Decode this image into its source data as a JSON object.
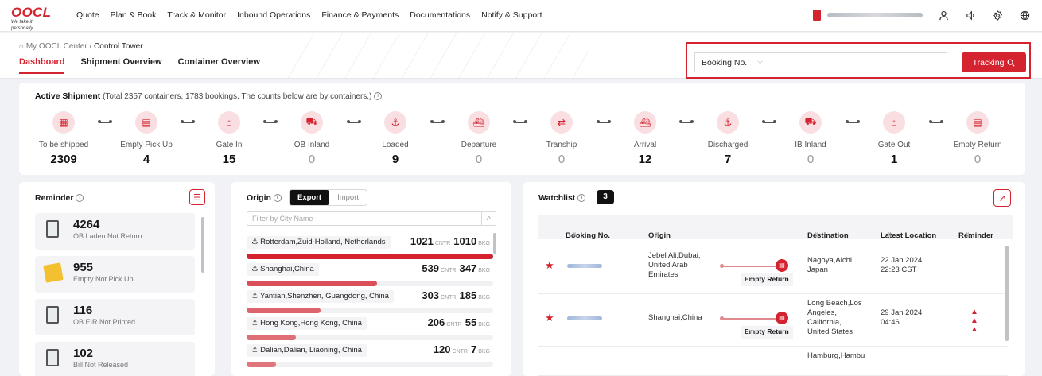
{
  "topbar": {
    "brand": "OOCL",
    "tagline": "We take it personally",
    "nav": [
      "Quote",
      "Plan & Book",
      "Track & Monitor",
      "Inbound Operations",
      "Finance & Payments",
      "Documentations",
      "Notify & Support"
    ]
  },
  "breadcrumb": {
    "root": "My OOCL Center",
    "sep": "/",
    "current": "Control Tower"
  },
  "tabs": [
    {
      "label": "Dashboard",
      "active": true
    },
    {
      "label": "Shipment Overview",
      "active": false
    },
    {
      "label": "Container Overview",
      "active": false
    }
  ],
  "search": {
    "type": "Booking No.",
    "button": "Tracking"
  },
  "active_shipment": {
    "title": "Active Shipment",
    "note": "(Total 2357 containers, 1783 bookings. The counts below are by containers.)",
    "stages": [
      {
        "label": "To be shipped",
        "count": "2309",
        "icon": "factory-icon"
      },
      {
        "label": "Empty Pick Up",
        "count": "4",
        "icon": "container-icon"
      },
      {
        "label": "Gate In",
        "count": "15",
        "icon": "gate-icon"
      },
      {
        "label": "OB Inland",
        "count": "0",
        "icon": "truck-icon"
      },
      {
        "label": "Loaded",
        "count": "9",
        "icon": "crane-icon"
      },
      {
        "label": "Departure",
        "count": "0",
        "icon": "ship-icon"
      },
      {
        "label": "Tranship",
        "count": "0",
        "icon": "tranship-icon"
      },
      {
        "label": "Arrival",
        "count": "12",
        "icon": "ship-icon"
      },
      {
        "label": "Discharged",
        "count": "7",
        "icon": "crane-icon"
      },
      {
        "label": "IB Inland",
        "count": "0",
        "icon": "truck-icon"
      },
      {
        "label": "Gate Out",
        "count": "1",
        "icon": "gate-icon"
      },
      {
        "label": "Empty Return",
        "count": "0",
        "icon": "container-icon"
      }
    ]
  },
  "reminder": {
    "title": "Reminder",
    "items": [
      {
        "count": "4264",
        "label": "OB Laden Not Return",
        "icon": "document-icon"
      },
      {
        "count": "955",
        "label": "Empty Not Pick Up",
        "icon": "box-icon"
      },
      {
        "count": "116",
        "label": "OB EIR Not Printed",
        "icon": "document-icon"
      },
      {
        "count": "102",
        "label": "Bill Not Released",
        "icon": "document-icon"
      }
    ]
  },
  "origin": {
    "title": "Origin",
    "export_label": "Export",
    "import_label": "Import",
    "filter_placeholder": "Filter by City Name",
    "unit_cntr": "CNTR",
    "unit_bkg": "BKG",
    "rows": [
      {
        "city": "Rotterdam,Zuid-Holland, Netherlands",
        "cntr": "1021",
        "bkg": "1010",
        "share": 1.0
      },
      {
        "city": "Shanghai,China",
        "cntr": "539",
        "bkg": "347",
        "share": 0.53
      },
      {
        "city": "Yantian,Shenzhen, Guangdong, China",
        "cntr": "303",
        "bkg": "185",
        "share": 0.3
      },
      {
        "city": "Hong Kong,Hong Kong, China",
        "cntr": "206",
        "bkg": "55",
        "share": 0.2
      },
      {
        "city": "Dalian,Dalian, Liaoning, China",
        "cntr": "120",
        "bkg": "7",
        "share": 0.12
      }
    ]
  },
  "watchlist": {
    "title": "Watchlist",
    "count": "3",
    "columns": [
      "Booking No.",
      "Origin",
      "Destination",
      "Latest Location",
      "Reminder"
    ],
    "rows": [
      {
        "origin": [
          "Jebel Ali,Dubai,",
          "United Arab",
          "Emirates"
        ],
        "status": "Empty Return",
        "destination": [
          "Nagoya,Aichi,",
          "Japan"
        ],
        "location": [
          "22 Jan 2024",
          "22:23 CST"
        ],
        "warnings": 0
      },
      {
        "origin": [
          "Shanghai,China"
        ],
        "status": "Empty Return",
        "destination": [
          "Long Beach,Los",
          "Angeles,",
          "California,",
          "United States"
        ],
        "location": [
          "29 Jan 2024",
          "04:46"
        ],
        "warnings": 3
      },
      {
        "origin": [],
        "status": "",
        "destination": [
          "Hamburg,Hambu"
        ],
        "location": [],
        "warnings": 0
      }
    ]
  }
}
